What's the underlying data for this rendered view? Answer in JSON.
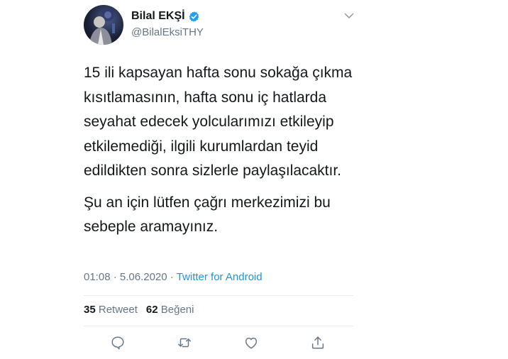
{
  "tweet": {
    "display_name": "Bilal EKŞİ",
    "handle": "@BilalEksiTHY",
    "paragraph_1": "15 ili kapsayan hafta sonu sokağa çıkma kısıtlamasının, hafta sonu iç hatlarda seyahat edecek yolcularımızı etkileyip etkilemediği, ilgili kurumlardan teyid edildikten sonra sizlerle paylaşılacaktır.",
    "paragraph_2": "Şu an için lütfen çağrı merkezimizi bu sebeple aramayınız.",
    "time": "01:08",
    "date": "5.06.2020",
    "separator": "·",
    "source": "Twitter for Android",
    "retweet_count": "35",
    "retweet_label": "Retweet",
    "like_count": "62",
    "like_label": "Beğeni"
  },
  "icons": {
    "verified": "verified-badge-icon",
    "caret": "chevron-down-icon",
    "reply": "reply-icon",
    "retweet": "retweet-icon",
    "like": "heart-icon",
    "share": "share-icon"
  },
  "colors": {
    "text": "#14171a",
    "secondary": "#657786",
    "link": "#1b95e0",
    "verified": "#1da1f2",
    "divider": "#e6ecf0"
  }
}
